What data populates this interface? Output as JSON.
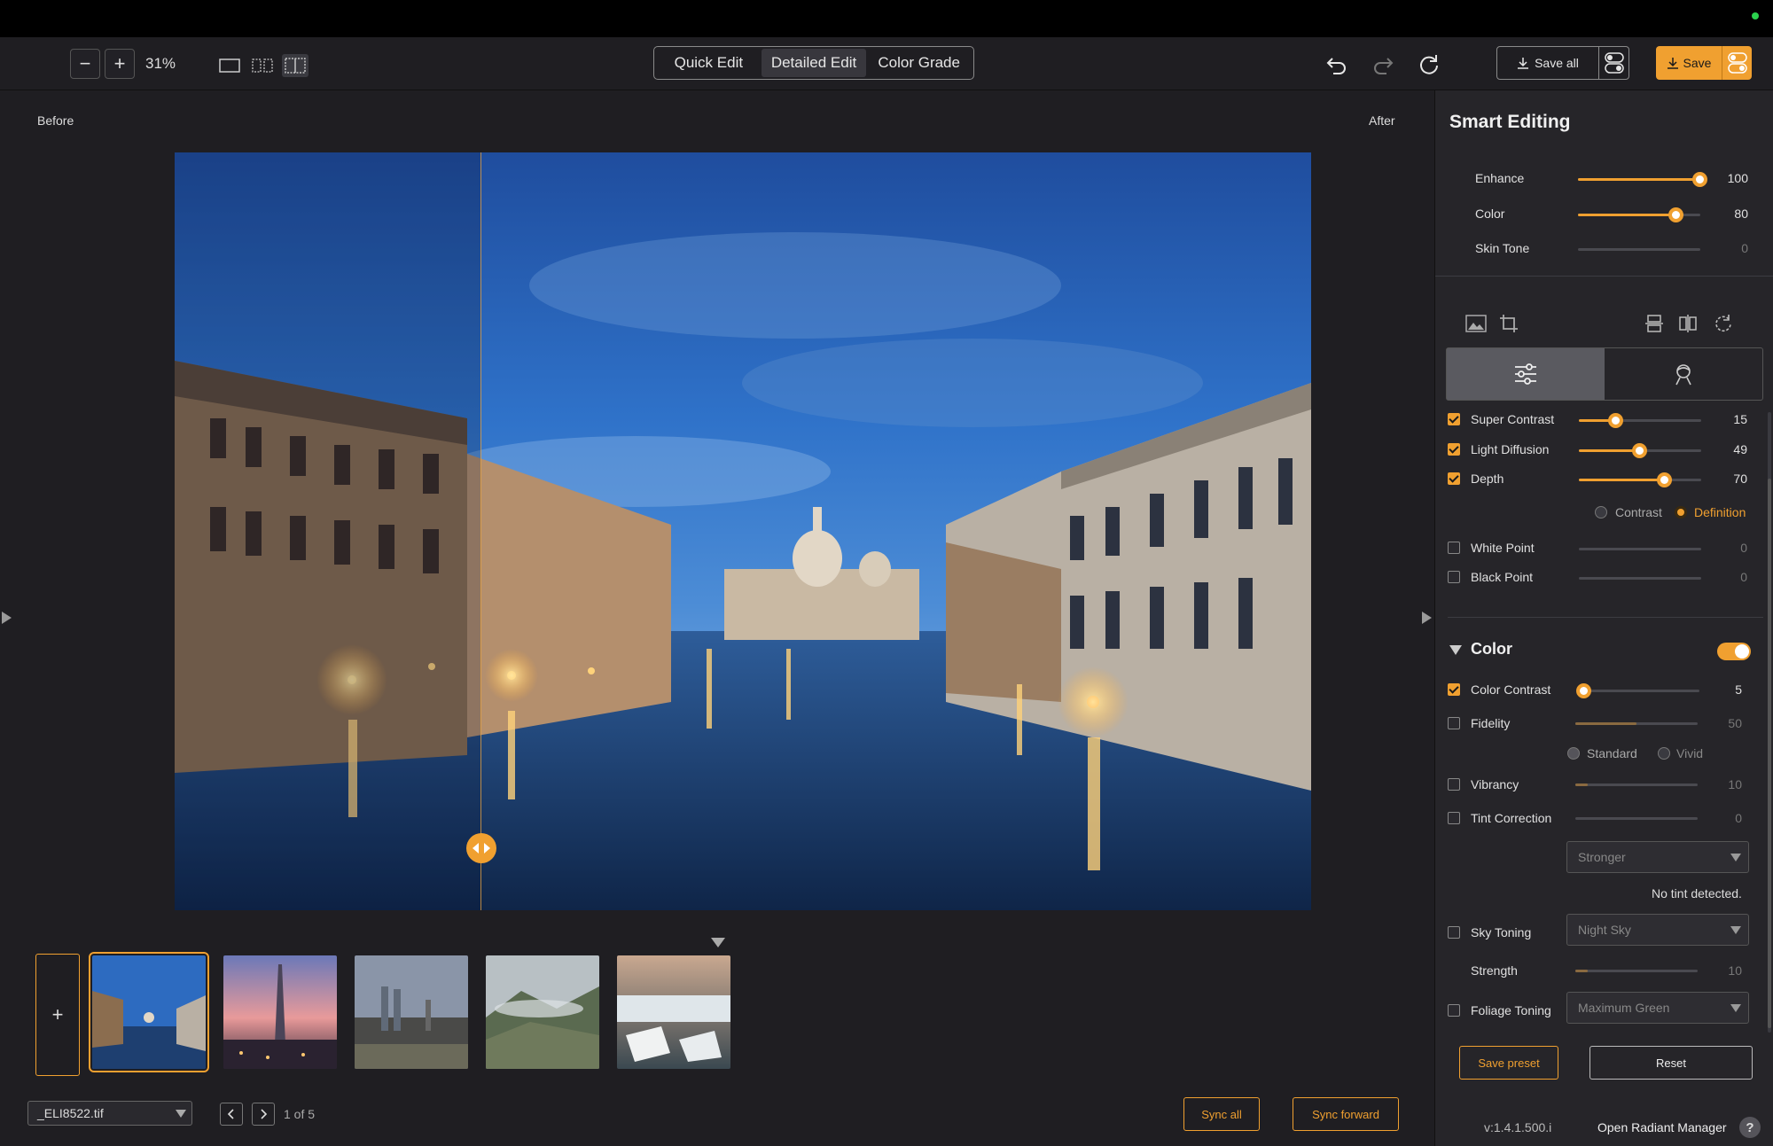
{
  "toolbar": {
    "zoom_out": "−",
    "zoom_in": "+",
    "zoom_level": "31%",
    "modes": [
      "Quick Edit",
      "Detailed Edit",
      "Color Grade"
    ],
    "active_mode": 1,
    "save_all_label": "Save all",
    "save_label": "Save"
  },
  "canvas": {
    "before_label": "Before",
    "after_label": "After"
  },
  "filmstrip": {
    "add_label": "+",
    "count": 5,
    "active_index": 0
  },
  "bottom": {
    "file_name": "_ELI8522.tif",
    "page_info": "1 of 5",
    "sync_all": "Sync all",
    "sync_forward": "Sync forward"
  },
  "panel": {
    "title": "Smart Editing",
    "smart": [
      {
        "label": "Enhance",
        "value": "100",
        "level": 1.0
      },
      {
        "label": "Color",
        "value": "80",
        "level": 0.8
      },
      {
        "label": "Skin Tone",
        "value": "0",
        "level": 0.0
      }
    ],
    "tone": [
      {
        "label": "Super Contrast",
        "value": "15",
        "checked": true,
        "level": 0.15
      },
      {
        "label": "Light Diffusion",
        "value": "49",
        "checked": true,
        "level": 0.49
      },
      {
        "label": "Depth",
        "value": "70",
        "checked": true,
        "level": 0.7
      }
    ],
    "depth_modes": {
      "a": "Contrast",
      "b": "Definition",
      "selected": "Definition"
    },
    "points": [
      {
        "label": "White Point",
        "value": "0",
        "checked": false
      },
      {
        "label": "Black Point",
        "value": "0",
        "checked": false
      }
    ],
    "color_section": {
      "title": "Color",
      "enabled": true,
      "color_contrast": {
        "label": "Color Contrast",
        "value": "5",
        "checked": true,
        "level": 0.05
      },
      "fidelity": {
        "label": "Fidelity",
        "value": "50",
        "checked": false,
        "level": 0.5
      },
      "fidelity_modes": {
        "a": "Standard",
        "b": "Vivid",
        "selected": "Standard"
      },
      "vibrancy": {
        "label": "Vibrancy",
        "value": "10",
        "checked": false,
        "level": 0.1
      },
      "tint": {
        "label": "Tint Correction",
        "value": "0",
        "checked": false,
        "level": 0.0
      },
      "tint_strength": "Stronger",
      "tint_note": "No tint detected.",
      "sky": {
        "label": "Sky Toning",
        "option": "Night Sky",
        "checked": false
      },
      "strength": {
        "label": "Strength",
        "value": "10",
        "level": 0.1
      },
      "foliage": {
        "label": "Foliage Toning",
        "option": "Maximum Green",
        "checked": false
      }
    },
    "save_preset": "Save preset",
    "reset": "Reset",
    "version": "v:1.4.1.500.i",
    "radiant_link": "Open Radiant Manager",
    "help": "?"
  },
  "colors": {
    "accent": "#f0a030",
    "background": "#1f1e22",
    "panel": "#262529"
  }
}
